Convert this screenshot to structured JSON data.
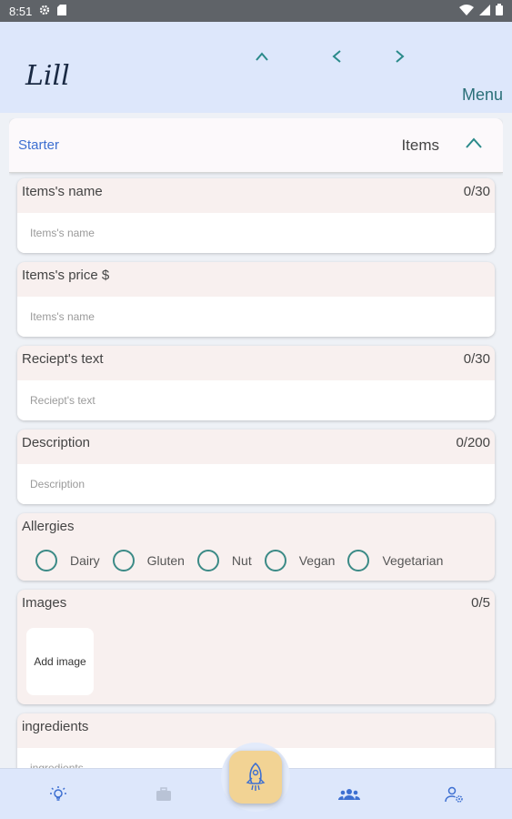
{
  "status_bar": {
    "time": "8:51"
  },
  "header": {
    "logo_text": "Lill",
    "menu_label": "Menu"
  },
  "section": {
    "link_label": "Starter",
    "title": "Items"
  },
  "fields": {
    "name": {
      "label": "Items's name",
      "count": "0/30",
      "placeholder": "Items's name"
    },
    "price": {
      "label": "Items's price $",
      "placeholder": "Items's name"
    },
    "receipt": {
      "label": "Reciept's text",
      "count": "0/30",
      "placeholder": "Reciept's text"
    },
    "description": {
      "label": "Description",
      "count": "0/200",
      "placeholder": "Description"
    },
    "allergies": {
      "label": "Allergies",
      "options": [
        "Dairy",
        "Gluten",
        "Nut",
        "Vegan",
        "Vegetarian"
      ]
    },
    "images": {
      "label": "Images",
      "count": "0/5",
      "add_label": "Add image"
    },
    "ingredients": {
      "label": "ingredients",
      "placeholder": "ingredients"
    }
  },
  "colors": {
    "accent": "#2a6f78",
    "header_bg": "#dde7fb",
    "card_bg": "#f8f0ef",
    "fab": "#f2d394"
  },
  "bottom_nav": {
    "items": [
      "lightbulb-icon",
      "briefcase-icon",
      "rocket-icon",
      "group-icon",
      "user-settings-icon"
    ]
  }
}
